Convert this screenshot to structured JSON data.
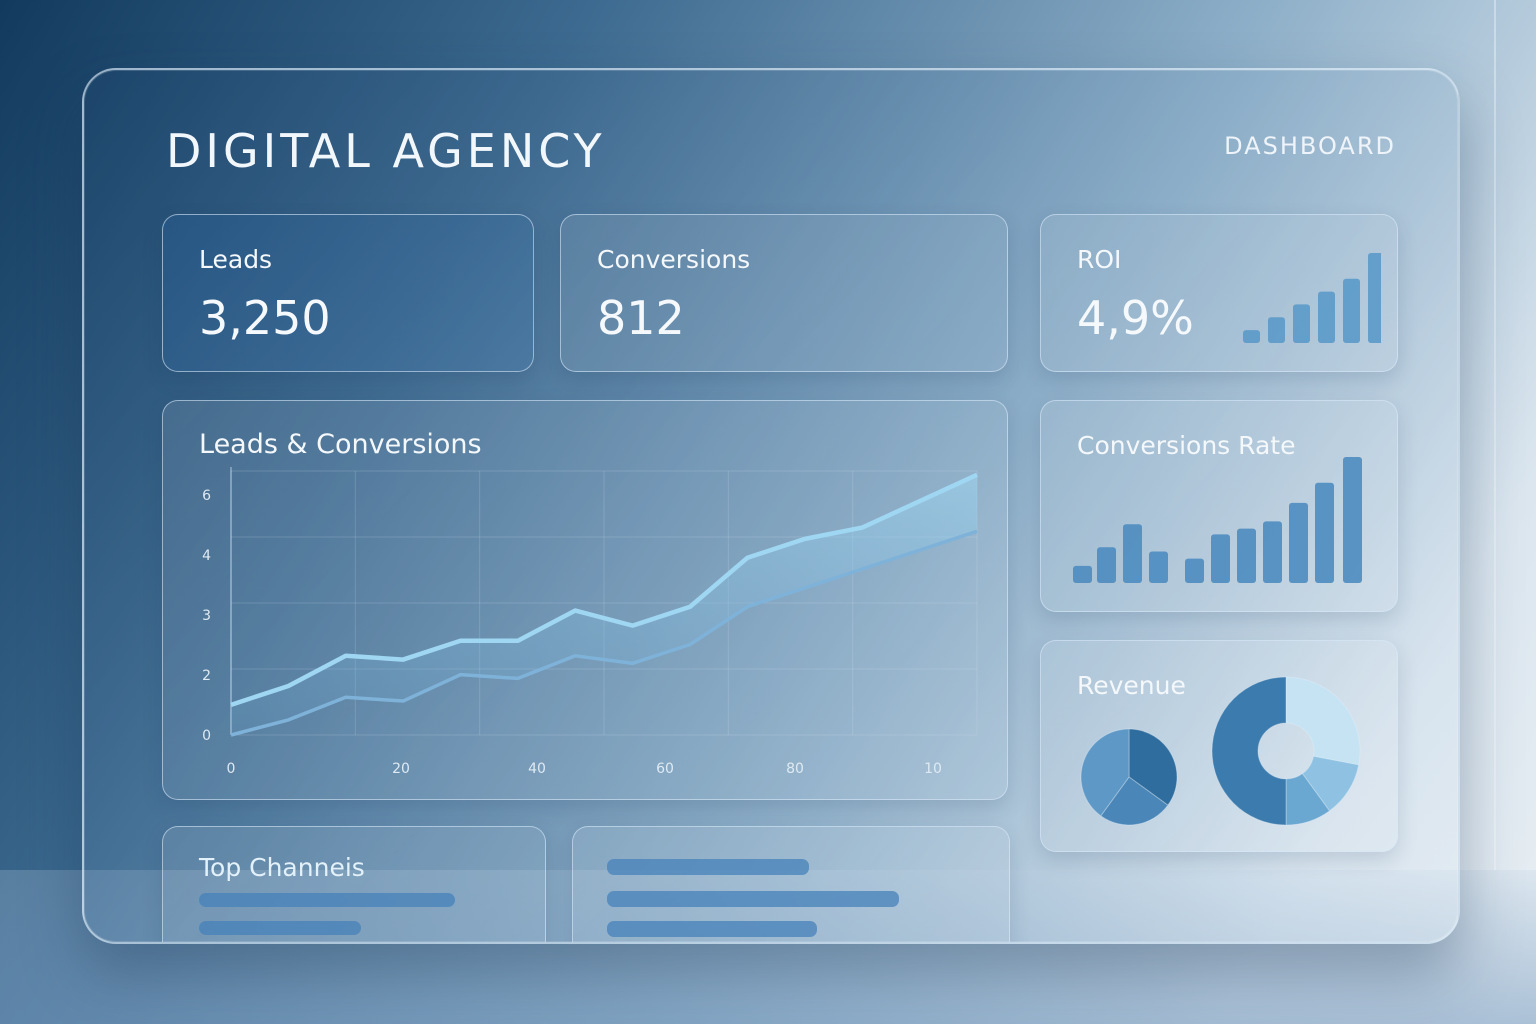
{
  "header": {
    "title": "DIGITAL AGENCY",
    "subtitle": "DASHBOARD"
  },
  "kpis": {
    "leads": {
      "label": "Leads",
      "value": "3,250"
    },
    "conversions": {
      "label": "Conversions",
      "value": "812"
    },
    "roi": {
      "label": "ROI",
      "value": "4,9%"
    }
  },
  "panels": {
    "rate_title": "Conversions Rate",
    "revenue_title": "Revenue",
    "channels_title": "Top Channeis"
  },
  "colors": {
    "accent": "#9fd6f2",
    "bar": "#4d8cc0",
    "line_secondary": "#7fb2d8"
  },
  "chart_data": [
    {
      "type": "line",
      "title": "Leads & Conversions",
      "x_tick_labels": [
        "0",
        "20",
        "40",
        "60",
        "80",
        "10"
      ],
      "y_tick_labels": [
        "0",
        "2",
        "3",
        "4",
        "6"
      ],
      "x": [
        0,
        10,
        20,
        30,
        40,
        50,
        60,
        70,
        80,
        90,
        100,
        110,
        120,
        130
      ],
      "series": [
        {
          "values": [
            0.8,
            1.3,
            2.1,
            2.0,
            2.5,
            2.5,
            3.3,
            2.9,
            3.4,
            4.7,
            5.2,
            5.5,
            6.2,
            6.9
          ]
        },
        {
          "values": [
            0.0,
            0.4,
            1.0,
            0.9,
            1.6,
            1.5,
            2.1,
            1.9,
            2.4,
            3.4,
            3.9,
            4.4,
            4.9,
            5.4
          ]
        }
      ],
      "grid": true
    },
    {
      "type": "bar",
      "values": [
        1,
        2,
        3,
        4,
        5,
        7
      ]
    },
    {
      "type": "bar",
      "values": [
        1.2,
        2.5,
        4.1,
        2.2,
        1.7,
        3.4,
        3.8,
        4.3,
        5.6,
        7.0,
        8.8
      ]
    },
    {
      "type": "pie",
      "values": [
        35,
        25,
        40
      ]
    },
    {
      "type": "pie",
      "values": [
        28,
        12,
        10,
        50
      ]
    }
  ]
}
